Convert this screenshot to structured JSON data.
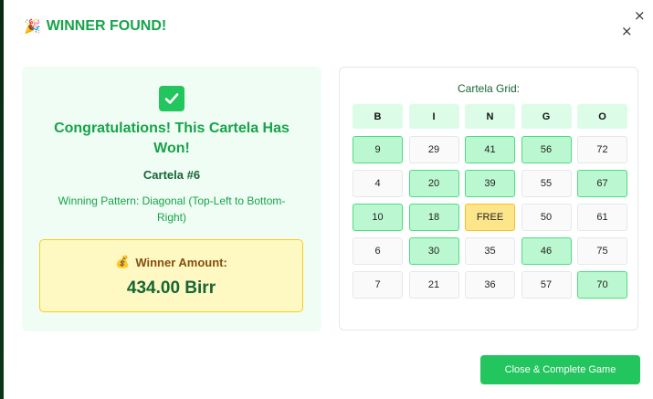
{
  "modal": {
    "title": "WINNER FOUND!",
    "title_icon": "🎉",
    "close_symbol": "×"
  },
  "winner": {
    "heading": "Congratulations! This Cartela Has Won!",
    "cartela_label": "Cartela #6",
    "pattern_text": "Winning Pattern: Diagonal (Top-Left to Bottom-Right)",
    "amount_label": "Winner Amount:",
    "amount_icon": "💰",
    "amount_value": "434.00 Birr"
  },
  "grid": {
    "title": "Cartela Grid:",
    "headers": [
      "B",
      "I",
      "N",
      "G",
      "O"
    ],
    "rows": [
      [
        {
          "v": "9",
          "m": true
        },
        {
          "v": "29",
          "m": false
        },
        {
          "v": "41",
          "m": true
        },
        {
          "v": "56",
          "m": true
        },
        {
          "v": "72",
          "m": false
        }
      ],
      [
        {
          "v": "4",
          "m": false
        },
        {
          "v": "20",
          "m": true
        },
        {
          "v": "39",
          "m": true
        },
        {
          "v": "55",
          "m": false
        },
        {
          "v": "67",
          "m": true
        }
      ],
      [
        {
          "v": "10",
          "m": true
        },
        {
          "v": "18",
          "m": true
        },
        {
          "v": "FREE",
          "m": false,
          "free": true
        },
        {
          "v": "50",
          "m": false
        },
        {
          "v": "61",
          "m": false
        }
      ],
      [
        {
          "v": "6",
          "m": false
        },
        {
          "v": "30",
          "m": true
        },
        {
          "v": "35",
          "m": false
        },
        {
          "v": "46",
          "m": true
        },
        {
          "v": "75",
          "m": false
        }
      ],
      [
        {
          "v": "7",
          "m": false
        },
        {
          "v": "21",
          "m": false
        },
        {
          "v": "36",
          "m": false
        },
        {
          "v": "57",
          "m": false
        },
        {
          "v": "70",
          "m": true
        }
      ]
    ]
  },
  "actions": {
    "close_game_label": "Close & Complete Game"
  },
  "colors": {
    "accent_green": "#16a34a",
    "marked_cell": "#bbf7d0",
    "free_cell": "#fde68a",
    "amount_box": "#fef9c3",
    "button": "#22c55e"
  }
}
